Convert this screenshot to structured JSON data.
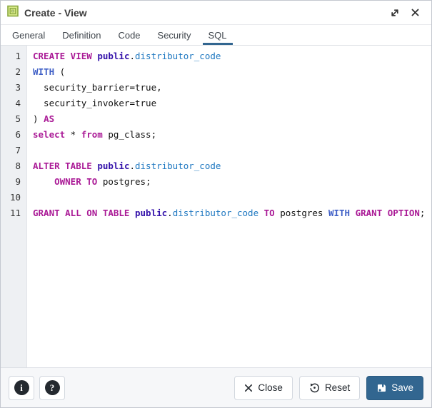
{
  "window": {
    "title": "Create - View",
    "icon": "view-icon",
    "controls": [
      {
        "name": "resize-icon"
      },
      {
        "name": "close-icon"
      }
    ]
  },
  "tabs": {
    "active_index": 4,
    "items": [
      {
        "label": "General"
      },
      {
        "label": "Definition"
      },
      {
        "label": "Code"
      },
      {
        "label": "Security"
      },
      {
        "label": "SQL"
      }
    ]
  },
  "editor": {
    "language": "sql",
    "line_count": 11,
    "token_legend": {
      "kw": "keyword",
      "kw2": "keyword-secondary",
      "obj": "schema-name",
      "name": "object-name",
      "pl": "plain"
    },
    "lines": [
      [
        [
          "kw",
          "CREATE VIEW "
        ],
        [
          "obj",
          "public"
        ],
        [
          "pl",
          "."
        ],
        [
          "name",
          "distributor_code"
        ]
      ],
      [
        [
          "kw2",
          "WITH"
        ],
        [
          "pl",
          " ("
        ]
      ],
      [
        [
          "pl",
          "  security_barrier=true,"
        ]
      ],
      [
        [
          "pl",
          "  security_invoker=true"
        ]
      ],
      [
        [
          "pl",
          ") "
        ],
        [
          "kw",
          "AS"
        ]
      ],
      [
        [
          "kw",
          "select"
        ],
        [
          "pl",
          " * "
        ],
        [
          "kw",
          "from"
        ],
        [
          "pl",
          " pg_class;"
        ]
      ],
      [],
      [
        [
          "kw",
          "ALTER TABLE "
        ],
        [
          "obj",
          "public"
        ],
        [
          "pl",
          "."
        ],
        [
          "name",
          "distributor_code"
        ]
      ],
      [
        [
          "pl",
          "    "
        ],
        [
          "kw",
          "OWNER TO"
        ],
        [
          "pl",
          " postgres;"
        ]
      ],
      [],
      [
        [
          "kw",
          "GRANT ALL ON TABLE "
        ],
        [
          "obj",
          "public"
        ],
        [
          "pl",
          "."
        ],
        [
          "name",
          "distributor_code"
        ],
        [
          "pl",
          " "
        ],
        [
          "kw",
          "TO"
        ],
        [
          "pl",
          " postgres "
        ],
        [
          "kw2",
          "WITH"
        ],
        [
          "pl",
          " "
        ],
        [
          "kw",
          "GRANT OPTION"
        ],
        [
          "pl",
          ";"
        ]
      ]
    ]
  },
  "footer": {
    "info_glyph": "i",
    "help_glyph": "?",
    "buttons": {
      "close": {
        "label": "Close",
        "icon": "x-icon"
      },
      "reset": {
        "label": "Reset",
        "icon": "reset-icon"
      },
      "save": {
        "label": "Save",
        "icon": "save-icon"
      }
    }
  },
  "colors": {
    "accent": "#326690",
    "tab_underline": "#326690",
    "keyword": "#aa1a96",
    "keyword_secondary": "#3f5fc6",
    "schema_name": "#3311aa",
    "object_name": "#1f78c1",
    "gutter_bg": "#eef0f3"
  }
}
